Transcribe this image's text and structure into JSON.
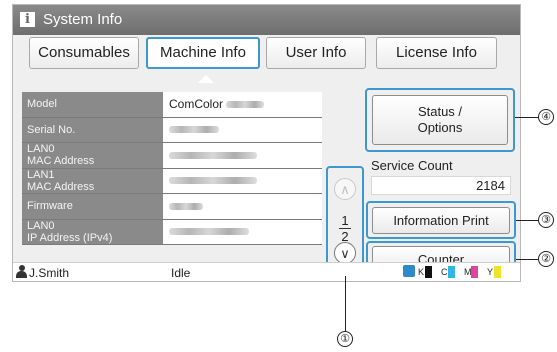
{
  "window": {
    "title": "System Info"
  },
  "tabs": [
    {
      "label": "Consumables",
      "active": false
    },
    {
      "label": "Machine Info",
      "active": true
    },
    {
      "label": "User Info",
      "active": false
    },
    {
      "label": "License Info",
      "active": false
    }
  ],
  "machine_info": [
    {
      "label_lines": [
        "Model"
      ],
      "value": "ComColor"
    },
    {
      "label_lines": [
        "Serial No."
      ],
      "value": ""
    },
    {
      "label_lines": [
        "LAN0",
        "MAC Address"
      ],
      "value": ""
    },
    {
      "label_lines": [
        "LAN1",
        "MAC Address"
      ],
      "value": ""
    },
    {
      "label_lines": [
        "Firmware"
      ],
      "value": ""
    },
    {
      "label_lines": [
        "LAN0",
        "IP Address (IPv4)"
      ],
      "value": ""
    }
  ],
  "pager": {
    "current": "1",
    "total": "2"
  },
  "buttons": {
    "status_options": [
      "Status /",
      "Options"
    ],
    "information_print": "Information Print",
    "counter": "Counter"
  },
  "service_count": {
    "label": "Service Count",
    "value": "2184"
  },
  "status_bar": {
    "user": "J.Smith",
    "status": "Idle",
    "inks": [
      {
        "letter": "K",
        "color": "#111111"
      },
      {
        "letter": "C",
        "color": "#2fb6e6"
      },
      {
        "letter": "M",
        "color": "#e0449a"
      },
      {
        "letter": "Y",
        "color": "#f2e22a"
      }
    ]
  },
  "callouts": [
    "①",
    "②",
    "③",
    "④"
  ],
  "colors": {
    "accent": "#3d98cc",
    "titlebar": "#7a7a7a",
    "label_cell": "#8a8a8a"
  }
}
